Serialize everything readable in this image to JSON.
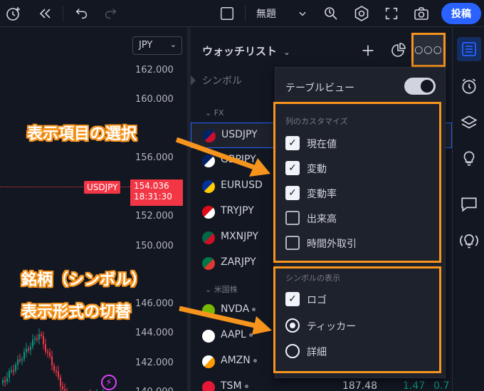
{
  "toolbar": {
    "layout_name": "無題",
    "post_label": "投稿",
    "icons": [
      "alert-add-icon",
      "replay-icon",
      "undo-icon",
      "redo-icon",
      "layout-icon",
      "chevron-down-icon",
      "quick-search-icon",
      "settings-icon",
      "fullscreen-icon",
      "camera-icon"
    ]
  },
  "chart": {
    "currency": "JPY",
    "price_scale": [
      "162.000",
      "160.000",
      "156.000",
      "152.000",
      "150.000",
      "146.000",
      "144.000",
      "142.000",
      "140.000"
    ],
    "symbol_tag": "USDJPY",
    "current_price": "154.036",
    "countdown": "18:31:30",
    "colors": {
      "up": "#089981",
      "down": "#f23645"
    }
  },
  "watchlist": {
    "title": "ウォッチリスト",
    "column_header": "シンボル",
    "groups": [
      {
        "label": "FX",
        "items": [
          {
            "symbol": "USDJPY",
            "selected": true,
            "flag": [
              "#012169",
              "#c8102e"
            ]
          },
          {
            "symbol": "GBPJPY",
            "display": "GBPJPY",
            "flag": [
              "#012169",
              "#ffffff"
            ]
          },
          {
            "symbol": "EURUSD",
            "flag": [
              "#003399",
              "#ffcc00"
            ]
          },
          {
            "symbol": "TRYJPY",
            "flag": [
              "#e30a17",
              "#ffffff"
            ]
          },
          {
            "symbol": "MXNJPY",
            "flag": [
              "#006847",
              "#ce1126"
            ]
          },
          {
            "symbol": "ZARJPY",
            "flag": [
              "#007749",
              "#de3831"
            ]
          }
        ]
      },
      {
        "label": "米国株",
        "items": [
          {
            "symbol": "NVDA",
            "flag": [
              "#76b900",
              "#76b900"
            ]
          },
          {
            "symbol": "AAPL",
            "flag": [
              "#ffffff",
              "#ffffff"
            ]
          },
          {
            "symbol": "AMZN",
            "flag": [
              "#ffffff",
              "#ff9900"
            ]
          },
          {
            "symbol": "TSM",
            "flag": [
              "#e51937",
              "#e51937"
            ],
            "last": "187.48",
            "change": "1.47",
            "change_pct": "0.7"
          }
        ]
      }
    ]
  },
  "menu": {
    "table_view_label": "テーブルビュー",
    "table_view_on": true,
    "columns_section": "列のカスタマイズ",
    "columns": [
      {
        "label": "現在値",
        "checked": true
      },
      {
        "label": "変動",
        "checked": true
      },
      {
        "label": "変動率",
        "checked": true
      },
      {
        "label": "出来高",
        "checked": false
      },
      {
        "label": "時間外取引",
        "checked": false
      }
    ],
    "symbol_section": "シンボルの表示",
    "logo_label": "ロゴ",
    "logo_checked": true,
    "display_modes": [
      {
        "label": "ティッカー",
        "selected": true
      },
      {
        "label": "詳細",
        "selected": false
      }
    ]
  },
  "sidebar_icons": [
    "watchlist-icon",
    "alarm-clock-icon",
    "layers-icon",
    "lightbulb-icon",
    "chat-icon",
    "idea-stream-icon"
  ],
  "annotations": {
    "callout1": "表示項目の選択",
    "callout2_line1": "銘柄（シンボル）",
    "callout2_line2": "表示形式の切替",
    "accent": "#f7941d"
  }
}
